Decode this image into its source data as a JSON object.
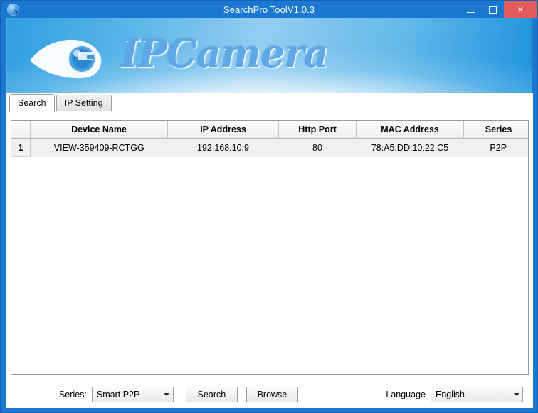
{
  "window": {
    "title": "SearchPro ToolV1.0.3",
    "app_icon": "magnifier-globe-icon",
    "minimize_label": "",
    "maximize_label": "",
    "close_label": "×",
    "frame_color": "#1a78d2",
    "close_button_color": "#e25b5b"
  },
  "banner": {
    "brand_text": "IPCamera",
    "logo_icon": "eye-camera-logo",
    "brand_color": "#5fa8e8"
  },
  "tabs": [
    {
      "label": "Search",
      "active": true
    },
    {
      "label": "IP Setting",
      "active": false
    }
  ],
  "table": {
    "columns": [
      {
        "key": "rownum",
        "label": ""
      },
      {
        "key": "device_name",
        "label": "Device Name"
      },
      {
        "key": "ip_address",
        "label": "IP Address"
      },
      {
        "key": "http_port",
        "label": "Http Port"
      },
      {
        "key": "mac_address",
        "label": "MAC Address"
      },
      {
        "key": "series",
        "label": "Series"
      }
    ],
    "rows": [
      {
        "rownum": "1",
        "device_name": "VIEW-359409-RCTGG",
        "ip_address": "192.168.10.9",
        "http_port": "80",
        "mac_address": "78:A5:DD:10:22:C5",
        "series": "P2P"
      }
    ]
  },
  "bottombar": {
    "series_label": "Series:",
    "series_value": "Smart P2P",
    "search_button": "Search",
    "browse_button": "Browse",
    "language_label": "Language",
    "language_value": "English"
  }
}
